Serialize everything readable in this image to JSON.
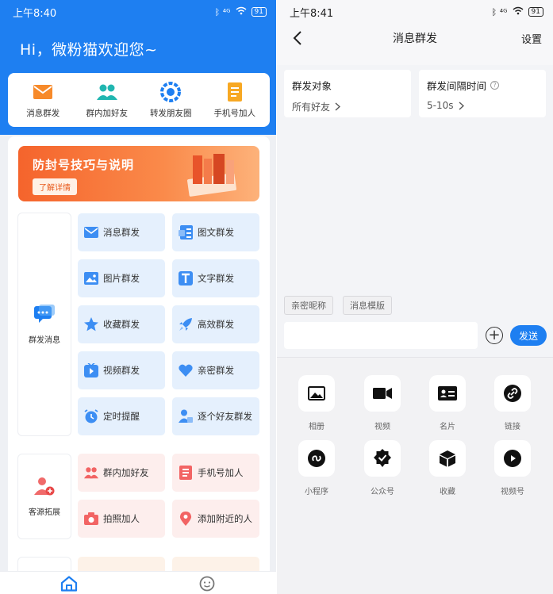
{
  "left": {
    "status": {
      "time": "上午8:40",
      "signal": "ᛒ ⁴ᴳ",
      "battery": "91"
    },
    "greeting": "Hi，微粉猫欢迎您~",
    "quick_actions": [
      {
        "label": "消息群发",
        "icon": "envelope-icon"
      },
      {
        "label": "群内加好友",
        "icon": "group-users-icon"
      },
      {
        "label": "转发朋友圈",
        "icon": "moments-camera-icon"
      },
      {
        "label": "手机号加人",
        "icon": "phone-book-icon"
      }
    ],
    "banner": {
      "title": "防封号技巧与说明",
      "button": "了解详情"
    },
    "groups": [
      {
        "label": "群发消息",
        "icon": "chat-bubble-icon"
      },
      {
        "label": "客源拓展",
        "icon": "add-user-icon"
      }
    ],
    "tiles": [
      {
        "label": "消息群发",
        "icon": "envelope-icon"
      },
      {
        "label": "图文群发",
        "icon": "image-text-icon"
      },
      {
        "label": "图片群发",
        "icon": "picture-icon"
      },
      {
        "label": "文字群发",
        "icon": "text-t-icon"
      },
      {
        "label": "收藏群发",
        "icon": "star-icon"
      },
      {
        "label": "高效群发",
        "icon": "rocket-icon"
      },
      {
        "label": "视频群发",
        "icon": "video-play-icon"
      },
      {
        "label": "亲密群发",
        "icon": "heart-icon"
      },
      {
        "label": "定时提醒",
        "icon": "alarm-clock-icon"
      },
      {
        "label": "逐个好友群发",
        "icon": "user-card-icon"
      },
      {
        "label": "群内加好友",
        "icon": "group-users-icon"
      },
      {
        "label": "手机号加人",
        "icon": "phone-book-icon"
      },
      {
        "label": "拍照加人",
        "icon": "camera-icon"
      },
      {
        "label": "添加附近的人",
        "icon": "location-pin-icon"
      }
    ],
    "nav": [
      {
        "icon": "home-icon"
      },
      {
        "icon": "profile-icon"
      }
    ]
  },
  "right": {
    "status": {
      "time": "上午8:41",
      "signal": "ᛒ ⁴ᴳ",
      "battery": "91"
    },
    "title": "消息群发",
    "settings": "设置",
    "target": {
      "title": "群发对象",
      "value": "所有好友"
    },
    "interval": {
      "title": "群发间隔时间",
      "value": "5-10s"
    },
    "chips": [
      "亲密昵称",
      "消息模版"
    ],
    "send": "发送",
    "attachments": [
      {
        "label": "相册",
        "icon": "album-icon"
      },
      {
        "label": "视频",
        "icon": "video-camera-icon"
      },
      {
        "label": "名片",
        "icon": "business-card-icon"
      },
      {
        "label": "链接",
        "icon": "link-icon"
      },
      {
        "label": "小程序",
        "icon": "mini-program-icon"
      },
      {
        "label": "公众号",
        "icon": "official-account-icon"
      },
      {
        "label": "收藏",
        "icon": "favorites-cube-icon"
      },
      {
        "label": "视频号",
        "icon": "channels-play-icon"
      }
    ]
  },
  "colors": {
    "primary": "#1e7ff1",
    "banner_orange": "#f5642c",
    "tile_blue": "#e5f0fd",
    "tile_pink": "#fdeeed"
  }
}
